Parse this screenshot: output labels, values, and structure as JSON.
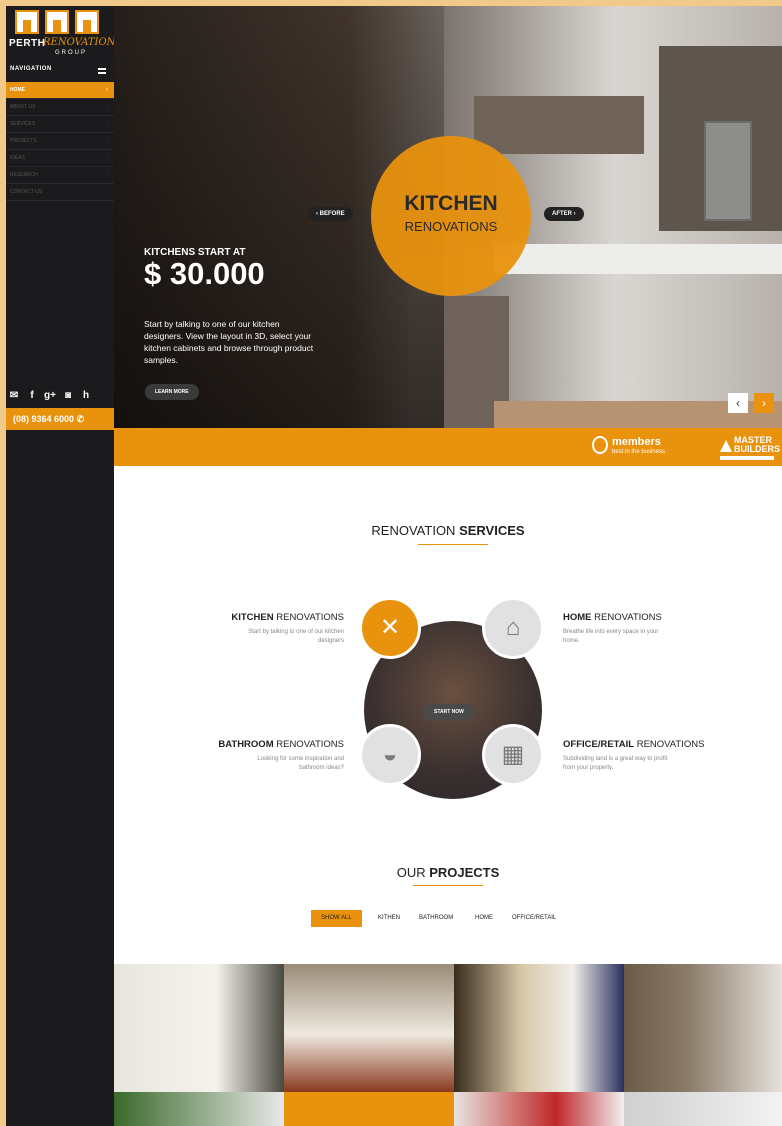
{
  "sidebar": {
    "logo": {
      "line1": "PERTH",
      "line2": "RENOVATION",
      "line3": "GROUP"
    },
    "nav_title": "NAVIGATION",
    "nav": [
      {
        "label": "HOME"
      },
      {
        "label": "ABOUT US"
      },
      {
        "label": "SERVICES"
      },
      {
        "label": "PROJECTS"
      },
      {
        "label": "IDEAS"
      },
      {
        "label": "RESEARCH"
      },
      {
        "label": "CONTACT US"
      }
    ],
    "social_icons": [
      "email-icon",
      "facebook-icon",
      "google-plus-icon",
      "instagram-icon",
      "houzz-icon"
    ],
    "phone": "(08) 9364 6000"
  },
  "hero": {
    "circle_title": "KITCHEN",
    "circle_subtitle": "RENOVATIONS",
    "before_label": "BEFORE",
    "after_label": "AFTER",
    "price_label": "KITCHENS START AT",
    "price": "$ 30.000",
    "description": "Start by talking to one of our kitchen designers. View the layout in 3D, select your kitchen cabinets and browse through product samples.",
    "cta": "LEARN MORE"
  },
  "band": {
    "members_title": "members",
    "members_sub": "best in the business",
    "mb_line1": "MASTER",
    "mb_line2": "BUILDERS"
  },
  "services": {
    "title_light": "RENOVATION ",
    "title_bold": "SERVICES",
    "start_now": "START NOW",
    "items": [
      {
        "bold": "KITCHEN",
        "rest": " RENOVATIONS",
        "desc": "Start by talking to one of our kitchen designers"
      },
      {
        "bold": "HOME",
        "rest": " RENOVATIONS",
        "desc": "Breathe life into every space in your home."
      },
      {
        "bold": "BATHROOM",
        "rest": " RENOVATIONS",
        "desc": "Looking for some inspiration and bathroom ideas?"
      },
      {
        "bold": "OFFICE/RETAIL",
        "rest": " RENOVATIONS",
        "desc": "Subdividing land is a great way to profit from your property."
      }
    ]
  },
  "projects": {
    "title_light": "OUR ",
    "title_bold": "PROJECTS",
    "filters": [
      "SHOW ALL",
      "KITHEN",
      "BATHROOM",
      "HOME",
      "OFFICE/RETAIL"
    ]
  },
  "colors": {
    "accent": "#e8920e",
    "sidebar": "#1b1b1d",
    "frame": "#f1c98a"
  }
}
